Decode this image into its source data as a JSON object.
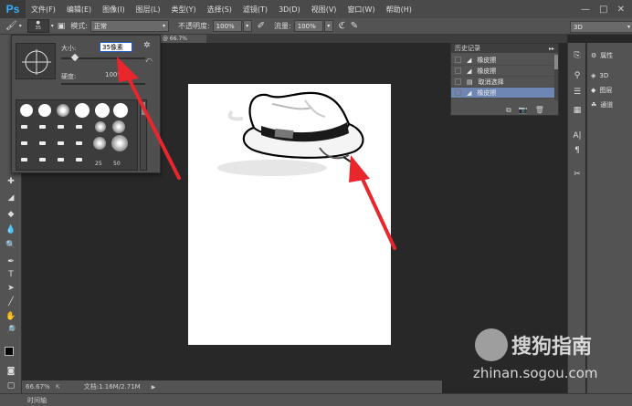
{
  "app": {
    "logo": "Ps"
  },
  "menu": [
    "文件(F)",
    "编辑(E)",
    "图像(I)",
    "图层(L)",
    "类型(Y)",
    "选择(S)",
    "滤镜(T)",
    "3D(D)",
    "视图(V)",
    "窗口(W)",
    "帮助(H)"
  ],
  "options": {
    "brush_size": "35",
    "mode_label": "模式:",
    "mode_value": "正常",
    "opacity_label": "不透明度:",
    "opacity_value": "100%",
    "flow_label": "流量:",
    "flow_value": "100%",
    "workspace": "3D"
  },
  "brush_panel": {
    "size_label": "大小:",
    "size_value": "35像素",
    "hardness_label": "硬度:",
    "hardness_value": "100%",
    "preset_numbers": [
      "25",
      "50"
    ]
  },
  "doc_tab": {
    "label": "@ 66.7%"
  },
  "history": {
    "title": "历史记录",
    "items": [
      {
        "label": "橡皮擦",
        "selected": false
      },
      {
        "label": "橡皮擦",
        "selected": false
      },
      {
        "label": "取消选择",
        "selected": false
      },
      {
        "label": "橡皮擦",
        "selected": true
      }
    ]
  },
  "right_dock": {
    "items": [
      "属性",
      "3D",
      "图层",
      "通道"
    ]
  },
  "status": {
    "zoom": "66.67%",
    "doc_info": "文档:1.16M/2.71M"
  },
  "timeline": {
    "label": "时间轴"
  },
  "watermark": {
    "brand": "搜狗指南",
    "url": "zhinan.sogou.com"
  },
  "colors": {
    "accent_red": "#e8262b",
    "history_selected": "#6d86b4"
  }
}
